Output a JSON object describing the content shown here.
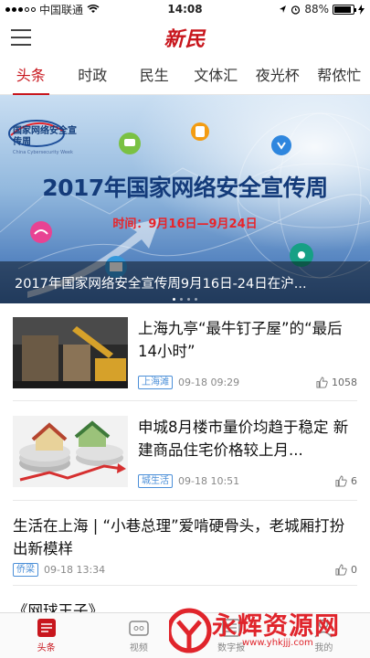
{
  "status": {
    "carrier": "中国联通",
    "time": "14:08",
    "battery": "88%",
    "battery_level": 0.88
  },
  "header": {
    "logo": "新民",
    "menu_icon": "hamburger-icon"
  },
  "tabs": [
    {
      "label": "头条",
      "active": true
    },
    {
      "label": "时政"
    },
    {
      "label": "民生"
    },
    {
      "label": "文体汇"
    },
    {
      "label": "夜光杯"
    },
    {
      "label": "帮侬忙"
    }
  ],
  "banner": {
    "emblem_title": "国家网络安全宣传周",
    "emblem_sub": "China Cybersecurity Week",
    "headline": "2017年国家网络安全宣传周",
    "date": "时间：9月16日—9月24日",
    "caption": "2017年国家网络安全宣传周9月16日-24日在沪...",
    "slide_count": 4,
    "active_slide": 1
  },
  "news": [
    {
      "title": "上海九亭“最牛钉子屋”的“最后14小时”",
      "tag": "上海滩",
      "time": "09-18 09:29",
      "likes": "1058"
    },
    {
      "title": "申城8月楼市量价均趋于稳定 新建商品住宅价格较上月...",
      "tag": "城生活",
      "time": "09-18 10:51",
      "likes": "6"
    },
    {
      "title": "生活在上海 | “小巷总理”爱啃硬骨头，老城厢打扮出新模样",
      "tag": "侨梁",
      "time": "09-18 13:34",
      "likes": "0"
    },
    {
      "title": "《网球王子》..."
    }
  ],
  "bottom_nav": [
    {
      "label": "头条",
      "icon": "news-icon",
      "active": true
    },
    {
      "label": "视频",
      "icon": "video-icon"
    },
    {
      "label": "数字报",
      "icon": "newspaper-icon"
    },
    {
      "label": "我的",
      "icon": "profile-icon"
    }
  ],
  "watermark": {
    "text": "永辉资源网",
    "url": "www.yhkjjj.com"
  },
  "colors": {
    "brand": "#c8161d",
    "tag": "#4b8fd8"
  }
}
